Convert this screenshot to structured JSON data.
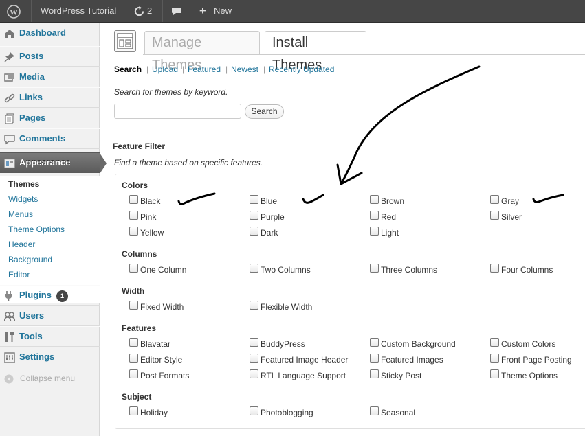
{
  "adminbar": {
    "site_name": "WordPress Tutorial",
    "updates_count": "2",
    "new_label": "New",
    "icons": [
      "wordpress-logo-icon",
      "refresh-icon",
      "comment-icon",
      "plus-icon"
    ]
  },
  "sidebar": {
    "items": [
      {
        "label": "Dashboard",
        "icon": "dashboard-icon"
      },
      {
        "label": "Posts",
        "icon": "pushpin-icon"
      },
      {
        "label": "Media",
        "icon": "media-icon"
      },
      {
        "label": "Links",
        "icon": "link-icon"
      },
      {
        "label": "Pages",
        "icon": "page-icon"
      },
      {
        "label": "Comments",
        "icon": "comment-icon"
      },
      {
        "label": "Appearance",
        "icon": "appearance-icon"
      },
      {
        "label": "Plugins",
        "icon": "plug-icon",
        "badge": "1"
      },
      {
        "label": "Users",
        "icon": "users-icon"
      },
      {
        "label": "Tools",
        "icon": "tools-icon"
      },
      {
        "label": "Settings",
        "icon": "settings-icon"
      }
    ],
    "appearance_submenu": [
      "Themes",
      "Widgets",
      "Menus",
      "Theme Options",
      "Header",
      "Background",
      "Editor"
    ],
    "collapse_label": "Collapse menu"
  },
  "tabs": {
    "manage": "Manage Themes",
    "install": "Install Themes"
  },
  "subnav": [
    "Search",
    "Upload",
    "Featured",
    "Newest",
    "Recently Updated"
  ],
  "search": {
    "hint": "Search for themes by keyword.",
    "button": "Search"
  },
  "filter": {
    "title": "Feature Filter",
    "hint": "Find a theme based on specific features.",
    "groups": {
      "colors": {
        "title": "Colors",
        "options": [
          "Black",
          "Blue",
          "Brown",
          "Gray",
          "Pink",
          "Purple",
          "Red",
          "Silver",
          "Yellow",
          "Dark",
          "Light"
        ]
      },
      "columns": {
        "title": "Columns",
        "options": [
          "One Column",
          "Two Columns",
          "Three Columns",
          "Four Columns"
        ]
      },
      "width": {
        "title": "Width",
        "options": [
          "Fixed Width",
          "Flexible Width"
        ]
      },
      "features": {
        "title": "Features",
        "options": [
          "Blavatar",
          "BuddyPress",
          "Custom Background",
          "Custom Colors",
          "Editor Style",
          "Featured Image Header",
          "Featured Images",
          "Front Page Posting",
          "Post Formats",
          "RTL Language Support",
          "Sticky Post",
          "Theme Options"
        ]
      },
      "subject": {
        "title": "Subject",
        "options": [
          "Holiday",
          "Photoblogging",
          "Seasonal"
        ]
      }
    }
  },
  "colors": {
    "adminbar_bg": "#464646",
    "link": "#21759b",
    "active_menu": "#6d6d6d"
  }
}
